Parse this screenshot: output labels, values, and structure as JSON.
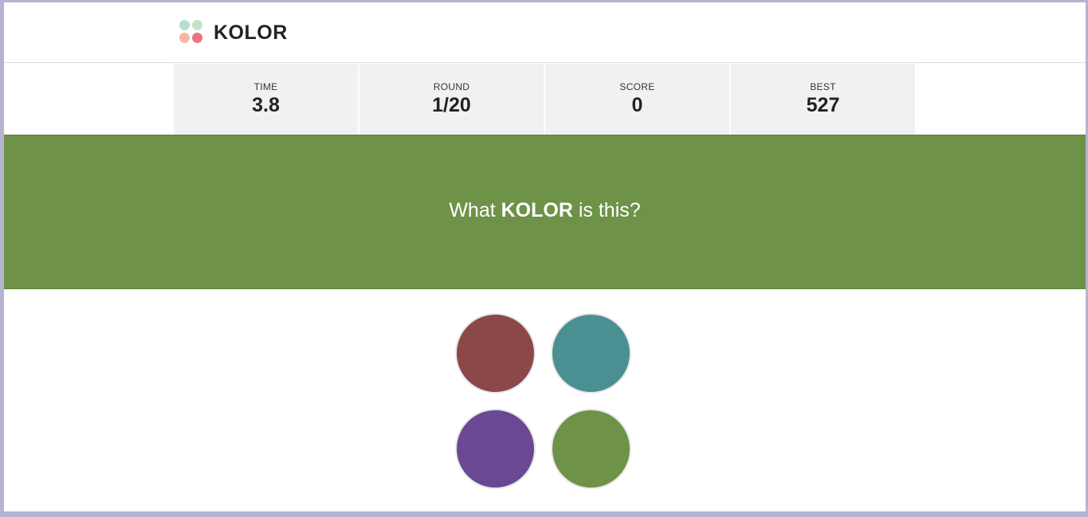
{
  "app": {
    "brand": "KOLOR",
    "logo_colors": [
      "#b3dfd0",
      "#c4e3c6",
      "#f8b8a3",
      "#ee7480"
    ]
  },
  "stats": [
    {
      "label": "TIME",
      "value": "3.8"
    },
    {
      "label": "ROUND",
      "value": "1/20"
    },
    {
      "label": "SCORE",
      "value": "0"
    },
    {
      "label": "BEST",
      "value": "527"
    }
  ],
  "question": {
    "prefix": "What ",
    "emphasis": "KOLOR",
    "suffix": " is this?",
    "color": "#6d9248"
  },
  "answers": [
    {
      "color": "#8c4849"
    },
    {
      "color": "#4a9092"
    },
    {
      "color": "#6a4893"
    },
    {
      "color": "#6d9248"
    }
  ]
}
